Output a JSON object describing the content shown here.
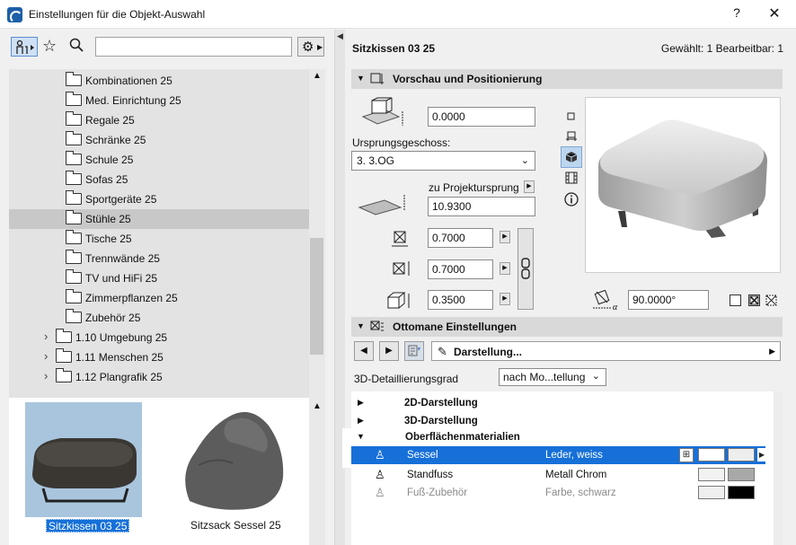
{
  "window": {
    "title": "Einstellungen für die Objekt-Auswahl",
    "help": "?",
    "close": "✕"
  },
  "left": {
    "search_value": "",
    "tree": [
      {
        "label": "Kombinationen 25",
        "level": 2,
        "selected": false
      },
      {
        "label": "Med. Einrichtung 25",
        "level": 2,
        "selected": false
      },
      {
        "label": "Regale 25",
        "level": 2,
        "selected": false
      },
      {
        "label": "Schränke 25",
        "level": 2,
        "selected": false
      },
      {
        "label": "Schule 25",
        "level": 2,
        "selected": false
      },
      {
        "label": "Sofas 25",
        "level": 2,
        "selected": false
      },
      {
        "label": "Sportgeräte 25",
        "level": 2,
        "selected": false
      },
      {
        "label": "Stühle 25",
        "level": 2,
        "selected": true
      },
      {
        "label": "Tische 25",
        "level": 2,
        "selected": false
      },
      {
        "label": "Trennwände 25",
        "level": 2,
        "selected": false
      },
      {
        "label": "TV und HiFi 25",
        "level": 2,
        "selected": false
      },
      {
        "label": "Zimmerpflanzen 25",
        "level": 2,
        "selected": false
      },
      {
        "label": "Zubehör 25",
        "level": 2,
        "selected": false
      },
      {
        "label": "1.10 Umgebung 25",
        "level": 1,
        "selected": false
      },
      {
        "label": "1.11 Menschen 25",
        "level": 1,
        "selected": false
      },
      {
        "label": "1.12 Plangrafik 25",
        "level": 1,
        "selected": false
      }
    ],
    "thumbnails": [
      {
        "caption": "Sitzkissen 03 25",
        "selected": true
      },
      {
        "caption": "Sitzsack Sessel 25",
        "selected": false
      }
    ]
  },
  "right": {
    "object_name": "Sitzkissen 03 25",
    "selection_count": "Gewählt: 1 Bearbeitbar: 1",
    "section_preview": "Vorschau und Positionierung",
    "elevation_value": "0.0000",
    "home_story_label": "Ursprungsgeschoss:",
    "home_story_value": "3. 3.OG",
    "project_origin_label": "zu Projektursprung",
    "project_origin_value": "10.9300",
    "dim_x": "0.7000",
    "dim_y": "0.7000",
    "dim_z": "0.3500",
    "angle_value": "90.0000°",
    "section_ottomane": "Ottomane Einstellungen",
    "darstellung_label": "Darstellung...",
    "detail_label": "3D-Detaillierungsgrad",
    "detail_value": "nach Mo...tellung",
    "groups": [
      {
        "label": "2D-Darstellung",
        "expanded": false
      },
      {
        "label": "3D-Darstellung",
        "expanded": false
      },
      {
        "label": "Oberflächenmaterialien",
        "expanded": true
      }
    ],
    "materials": [
      {
        "name": "Sessel",
        "value": "Leder, weiss",
        "selected": true,
        "color1": "#ffffff",
        "color2": "#eeeeee"
      },
      {
        "name": "Standfuss",
        "value": "Metall Chrom",
        "selected": false,
        "color1": "#f2f2f2",
        "color2": "#a8a8a8"
      },
      {
        "name": "Fuß-Zubehör",
        "value": "Farbe, schwarz",
        "selected": false,
        "color1": "#efefef",
        "color2": "#000000"
      }
    ]
  }
}
